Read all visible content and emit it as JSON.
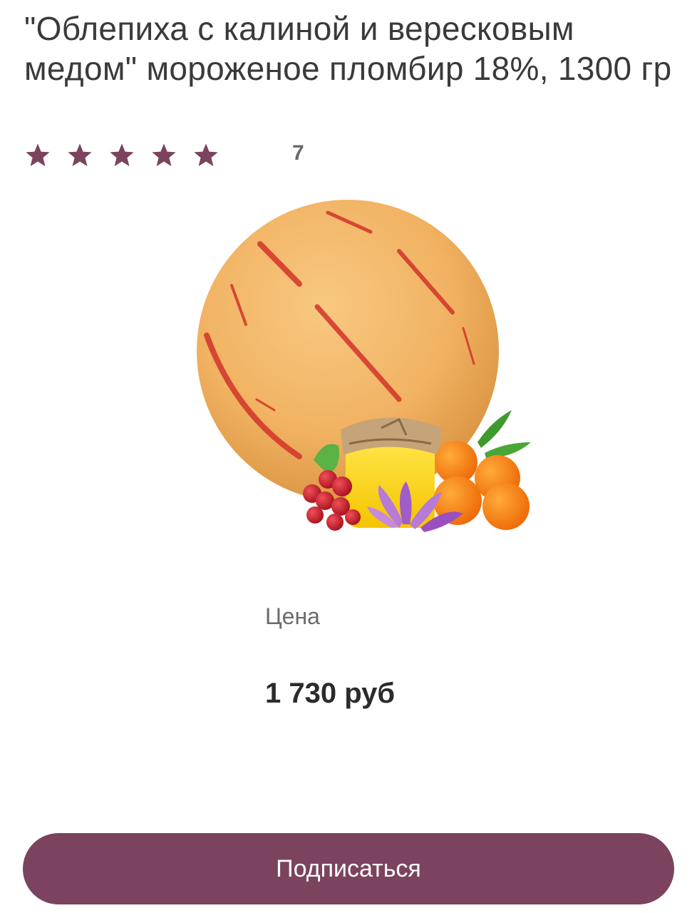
{
  "product": {
    "title": "\"Облепиха с калиной и вересковым медом\" мороженое пломбир 18%, 1300 гр",
    "rating": {
      "stars": 5,
      "max_stars": 5,
      "review_count": "7",
      "star_color": "#7b435e"
    },
    "image_icon": "ice-cream-scoop-with-sea-buckthorn-viburnum-honey"
  },
  "price": {
    "label": "Цена",
    "value": "1 730 руб"
  },
  "actions": {
    "subscribe_label": "Подписаться",
    "button_color": "#7b435e"
  }
}
